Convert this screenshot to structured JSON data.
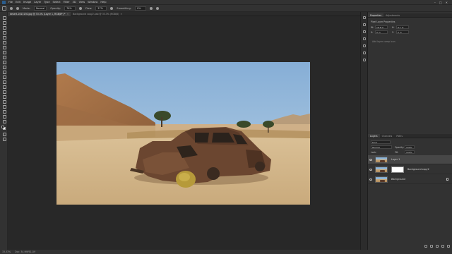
{
  "menubar": {
    "items": [
      "File",
      "Edit",
      "Image",
      "Layer",
      "Type",
      "Select",
      "Filter",
      "3D",
      "View",
      "Window",
      "Help"
    ],
    "window_controls": [
      "–",
      "□",
      "✕"
    ]
  },
  "options": {
    "mode_label": "Mode:",
    "mode_value": "Normal",
    "opacity_label": "Opacity:",
    "opacity_value": "76%",
    "flow_label": "Flow:",
    "flow_value": "37%",
    "smoothing_label": "Smoothing:",
    "smoothing_value": "0%"
  },
  "tabs": [
    {
      "label": "desert-1613130.jpg @ 33.3% (Layer 1, RGB/8*) *",
      "active": true
    },
    {
      "label": "Background copy2.psb @ 33.3% (RGB/8)",
      "active": false
    }
  ],
  "status": {
    "zoom": "33.33%",
    "doc": "Doc: 34.9M/92.1M"
  },
  "properties_panel": {
    "tabs": [
      "Properties",
      "Adjustments"
    ],
    "title": "Pixel Layer Properties",
    "w_label": "W:",
    "w_value": "18.8 in",
    "h_label": "H:",
    "h_value": "8.1 in",
    "x_label": "X:",
    "x_value": "0 in",
    "y_label": "Y:",
    "y_value": "0 in",
    "hint": "Add layer comp icon"
  },
  "layers_panel": {
    "tabs": [
      "Layers",
      "Channels",
      "Paths"
    ],
    "kind_label": "Kind",
    "blend_mode": "Normal",
    "opacity_label": "Opacity:",
    "opacity_value": "100%",
    "lock_label": "Lock:",
    "fill_label": "Fill:",
    "fill_value": "100%",
    "layers": [
      {
        "name": "Layer 1",
        "selected": true,
        "has_mask": false
      },
      {
        "name": "Background copy2",
        "selected": false,
        "has_mask": true
      },
      {
        "name": "Background",
        "selected": false,
        "has_mask": false
      }
    ]
  },
  "colors": {
    "foreground": "#0a0a0a",
    "background": "#ffffff",
    "ui_dark": "#282828",
    "ui_panel": "#323232"
  }
}
